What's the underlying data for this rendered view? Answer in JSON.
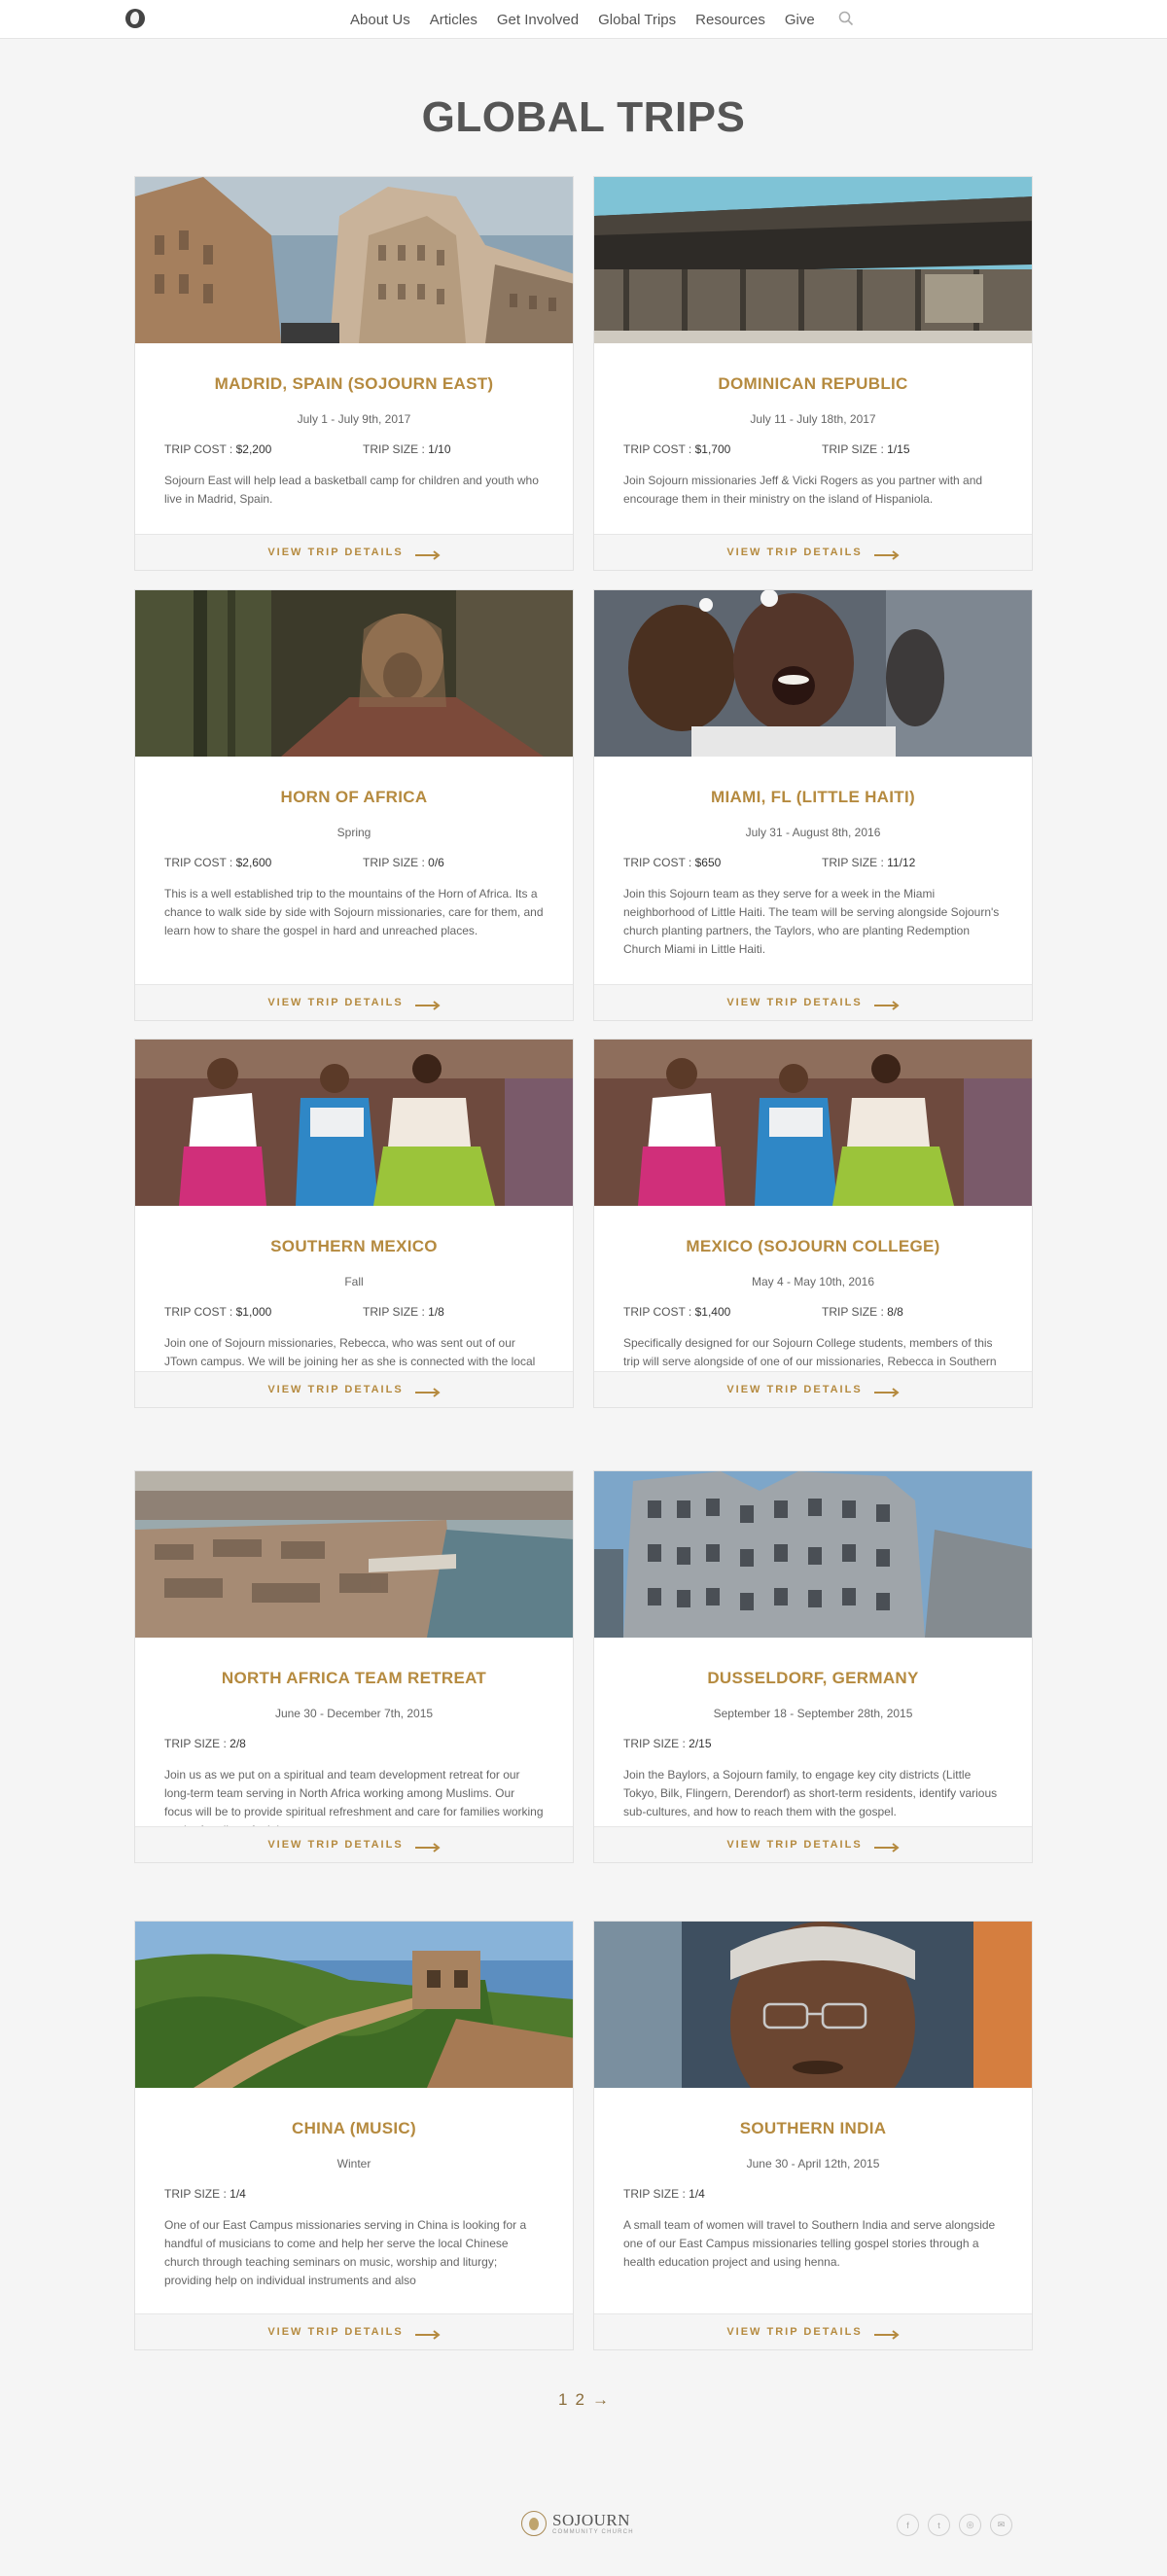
{
  "nav": {
    "links": [
      {
        "label": "About Us"
      },
      {
        "label": "Articles"
      },
      {
        "label": "Get Involved"
      },
      {
        "label": "Global Trips"
      },
      {
        "label": "Resources"
      },
      {
        "label": "Give"
      }
    ]
  },
  "page_title": "GLOBAL TRIPS",
  "details_label": "VIEW TRIP DETAILS",
  "accent_color": "#b58a3f",
  "trips": [
    {
      "title": "MADRID, SPAIN (SOJOURN EAST)",
      "date": "July 1 - July 9th, 2017",
      "cost_label": "TRIP COST :",
      "cost": "$2,200",
      "size_label": "TRIP SIZE :",
      "size": "1/10",
      "description": "Sojourn East will help lead a basketball camp for children and youth who live in Madrid, Spain.",
      "image": "madrid-architecture"
    },
    {
      "title": "DOMINICAN REPUBLIC",
      "date": "July 11 - July 18th, 2017",
      "cost_label": "TRIP COST :",
      "cost": "$1,700",
      "size_label": "TRIP SIZE :",
      "size": "1/15",
      "description": "Join Sojourn missionaries Jeff & Vicki Rogers as you partner with and encourage them in their ministry on the island of Hispaniola.",
      "image": "wooden-shack"
    },
    {
      "title": "HORN OF AFRICA",
      "date": "Spring",
      "cost_label": "TRIP COST :",
      "cost": "$2,600",
      "size_label": "TRIP SIZE :",
      "size": "0/6",
      "description": "This is a well established trip to the mountains of the Horn of Africa. Its a chance to walk side by side with Sojourn missionaries, care for them, and learn how to share the gospel in hard and unreached places.",
      "image": "man-in-shawl"
    },
    {
      "title": "MIAMI, FL (LITTLE HAITI)",
      "date": "July 31 - August 8th, 2016",
      "cost_label": "TRIP COST :",
      "cost": "$650",
      "size_label": "TRIP SIZE :",
      "size": "11/12",
      "description": "Join this Sojourn team as they serve for a week in the Miami neighborhood of Little Haiti. The team will be serving alongside Sojourn's church planting partners, the Taylors, who are planting Redemption Church Miami in Little Haiti.",
      "image": "laughing-children"
    },
    {
      "title": "SOUTHERN MEXICO",
      "date": "Fall",
      "cost_label": "TRIP COST :",
      "cost": "$1,000",
      "size_label": "TRIP SIZE :",
      "size": "1/8",
      "description": "Join one of Sojourn missionaries, Rebecca, who was sent out of our JTown campus.  We will be  joining her as she is connected with the local church there.",
      "image": "market-women"
    },
    {
      "title": "MEXICO (SOJOURN COLLEGE)",
      "date": "May 4 - May 10th, 2016",
      "cost_label": "TRIP COST :",
      "cost": "$1,400",
      "size_label": "TRIP SIZE :",
      "size": "8/8",
      "description": "Specifically designed for our Sojourn College students, members of this trip will serve alongside of one of our missionaries, Rebecca in Southern Mexico.",
      "image": "market-women"
    },
    {
      "title": "NORTH AFRICA TEAM RETREAT",
      "date": "June 30 - December 7th, 2015",
      "cost_label": "",
      "cost": "",
      "size_label": "TRIP SIZE :",
      "size": "2/8",
      "description": "Join us as we put on a spiritual and team development retreat for our long-term team serving in North Africa working among Muslims. Our focus will be to provide spiritual refreshment and care for families working on the frontline of ministry.",
      "image": "harbor-city"
    },
    {
      "title": "DUSSELDORF, GERMANY",
      "date": "September 18 - September 28th, 2015",
      "cost_label": "",
      "cost": "",
      "size_label": "TRIP SIZE :",
      "size": "2/15",
      "description": "Join the Baylors, a Sojourn family, to engage key city districts (Little Tokyo, Bilk, Flingern, Derendorf) as short-term residents, identify various sub-cultures, and how to reach them with the gospel.",
      "image": "wavy-building"
    },
    {
      "title": "CHINA (MUSIC)",
      "date": "Winter",
      "cost_label": "",
      "cost": "",
      "size_label": "TRIP SIZE :",
      "size": "1/4",
      "description": "One of our East Campus missionaries serving in China is looking for a handful of musicians to come and help her serve the local Chinese church through teaching seminars on music, worship and liturgy; providing help on individual instruments and also",
      "image": "great-wall"
    },
    {
      "title": "SOUTHERN INDIA",
      "date": "June 30 - April 12th, 2015",
      "cost_label": "",
      "cost": "",
      "size_label": "TRIP SIZE :",
      "size": "1/4",
      "description": "A small team of women will travel to Southern India and serve alongside one of our East Campus missionaries telling gospel stories through a health education project and using henna.",
      "image": "woman-glasses"
    }
  ],
  "pagination": {
    "pages": [
      "1",
      "2"
    ],
    "next": "→"
  },
  "footer": {
    "logo_name": "SOJOURN",
    "logo_sub": "COMMUNITY CHURCH",
    "socials": [
      {
        "icon": "facebook-icon",
        "glyph": "f"
      },
      {
        "icon": "twitter-icon",
        "glyph": "t"
      },
      {
        "icon": "instagram-icon",
        "glyph": "◎"
      },
      {
        "icon": "email-icon",
        "glyph": "✉"
      }
    ]
  }
}
